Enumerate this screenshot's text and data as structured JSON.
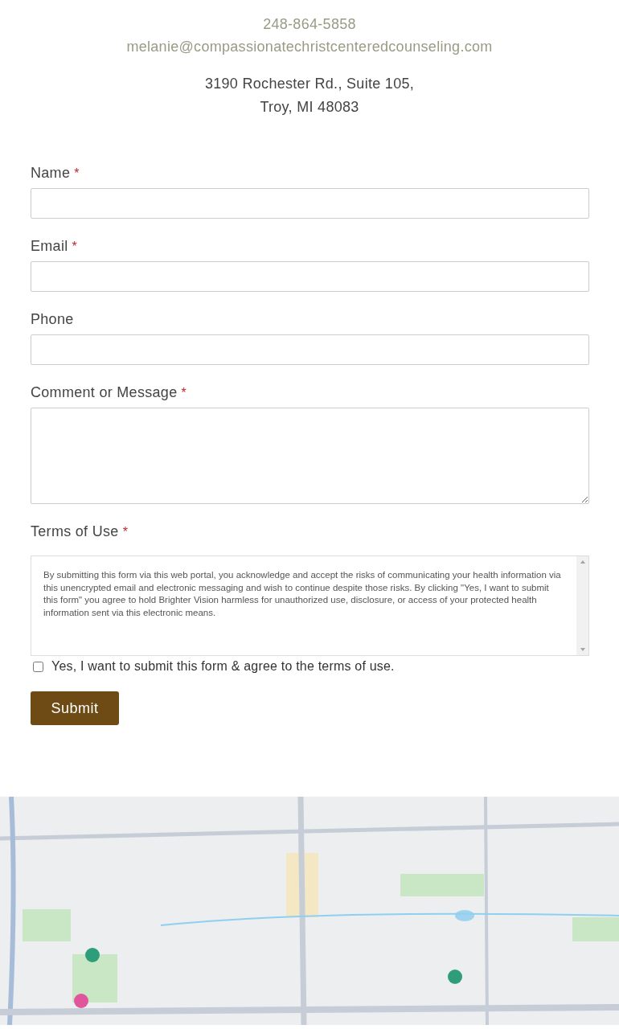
{
  "contact": {
    "phone": "248-864-5858",
    "email": "melanie@compassionatechristcenteredcounseling.com",
    "address_lines": [
      "3190 Rochester Rd., Suite 105,",
      "Troy, MI 48083"
    ]
  },
  "form": {
    "fields": [
      {
        "label": "Name",
        "required": true,
        "kind": "input"
      },
      {
        "label": "Email",
        "required": true,
        "kind": "input"
      },
      {
        "label": "Phone",
        "required": false,
        "kind": "input"
      },
      {
        "label": "Comment or Message",
        "required": true,
        "kind": "textarea"
      },
      {
        "label": "Terms of Use",
        "required": true,
        "kind": "terms",
        "text": "By submitting this form via this web portal, you acknowledge and accept the risks of communicating your health information via this unencrypted email and electronic messaging and wish to continue despite those risks. By clicking \"Yes, I want to submit this form\" you agree to hold Brighter Vision harmless for unauthorized use, disclosure, or access of your protected health information sent via this electronic means."
      }
    ],
    "required_mark": "*",
    "agree": {
      "label": "Yes, I want to submit this form & agree to the terms of use.",
      "checked": false
    },
    "submit": "Submit"
  }
}
